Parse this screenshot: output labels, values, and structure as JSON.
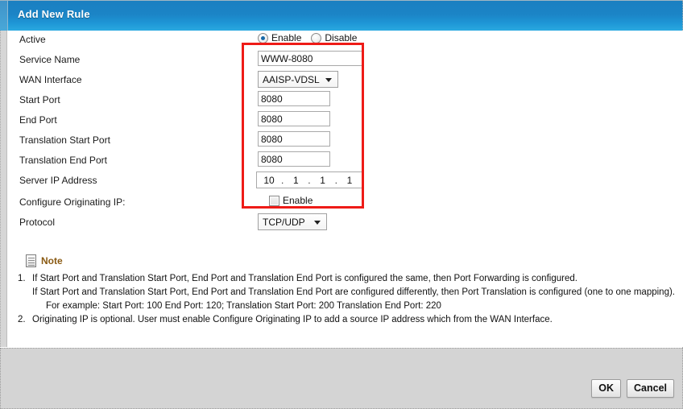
{
  "window": {
    "title": "Add New Rule"
  },
  "colors": {
    "header_blue_top": "#1a7fc1",
    "header_blue_bottom": "#2aa9e0",
    "highlight_red": "#ee1b17",
    "note_title": "#8a5a12",
    "footer_grey": "#d4d4d4"
  },
  "form": {
    "rows": [
      {
        "label": "Active",
        "type": "radio-group"
      },
      {
        "label": "Service Name",
        "type": "text"
      },
      {
        "label": "WAN Interface",
        "type": "select"
      },
      {
        "label": "Start Port",
        "type": "text"
      },
      {
        "label": "End Port",
        "type": "text"
      },
      {
        "label": "Translation Start Port",
        "type": "text"
      },
      {
        "label": "Translation End Port",
        "type": "text"
      },
      {
        "label": "Server IP Address",
        "type": "ip"
      },
      {
        "label": "Configure Originating IP:",
        "type": "checkbox"
      },
      {
        "label": "Protocol",
        "type": "select"
      }
    ],
    "active": {
      "enable_label": "Enable",
      "disable_label": "Disable",
      "selected": "Enable"
    },
    "service_name": {
      "value": "WWW-8080",
      "placeholder": ""
    },
    "wan_interface": {
      "value": "AAISP-VDSL"
    },
    "start_port": {
      "value": "8080",
      "placeholder": ""
    },
    "end_port": {
      "value": "8080",
      "placeholder": ""
    },
    "translation_start_port": {
      "value": "8080",
      "placeholder": ""
    },
    "translation_end_port": {
      "value": "8080",
      "placeholder": ""
    },
    "server_ip": {
      "octet1": "10",
      "octet2": "1",
      "octet3": "1",
      "octet4": "1",
      "separator": "."
    },
    "configure_originating_ip": {
      "enable_label": "Enable",
      "checked": false
    },
    "protocol": {
      "value": "TCP/UDP"
    }
  },
  "note": {
    "icon": "document-icon",
    "title": "Note",
    "items": [
      {
        "number": "1.",
        "line1": "If Start Port and Translation Start Port, End Port and Translation End Port is configured the same, then Port Forwarding is configured.",
        "line2": "If Start Port and Translation Start Port, End Port and Translation End Port are configured differently, then Port Translation is configured (one to one mapping).",
        "line3": "For example: Start Port: 100 End Port: 120; Translation Start Port: 200 Translation End Port: 220"
      },
      {
        "number": "2.",
        "line1": "Originating IP is optional. User must enable Configure Originating IP to add a source IP address which from the WAN Interface.",
        "line2": "",
        "line3": ""
      }
    ]
  },
  "footer": {
    "ok_label": "OK",
    "cancel_label": "Cancel"
  }
}
